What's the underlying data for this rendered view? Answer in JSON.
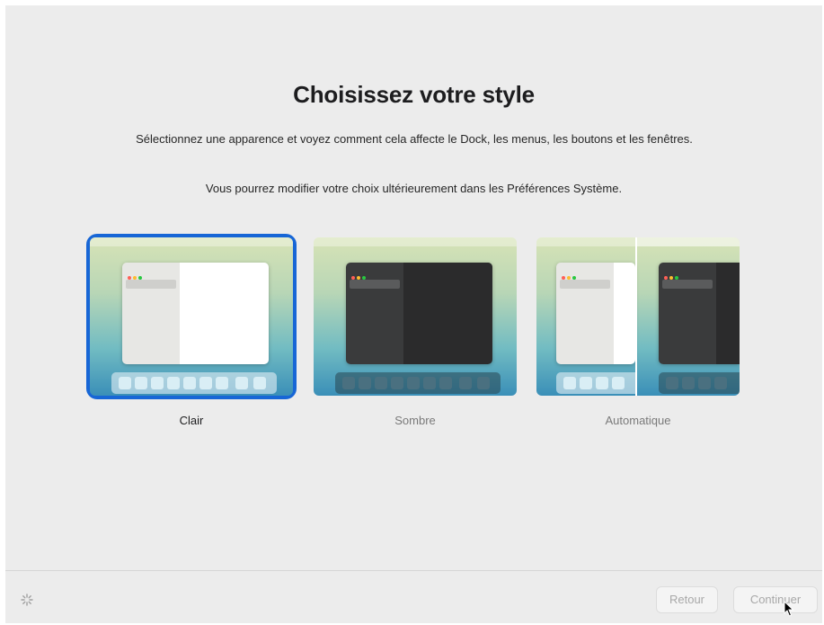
{
  "title": "Choisissez votre style",
  "subtitle": "Sélectionnez une apparence et voyez comment cela affecte le Dock, les menus, les boutons et les fenêtres.",
  "note": "Vous pourrez modifier votre choix ultérieurement dans les Préférences Système.",
  "options": [
    {
      "label": "Clair",
      "selected": true
    },
    {
      "label": "Sombre",
      "selected": false
    },
    {
      "label": "Automatique",
      "selected": false
    }
  ],
  "buttons": {
    "back": "Retour",
    "continue": "Continuer"
  },
  "colors": {
    "accent": "#1766d6",
    "background": "#ececec"
  },
  "icons": {
    "spinner": "spinner-icon",
    "apple": "apple-logo-icon",
    "cursor": "mouse-pointer-icon"
  }
}
